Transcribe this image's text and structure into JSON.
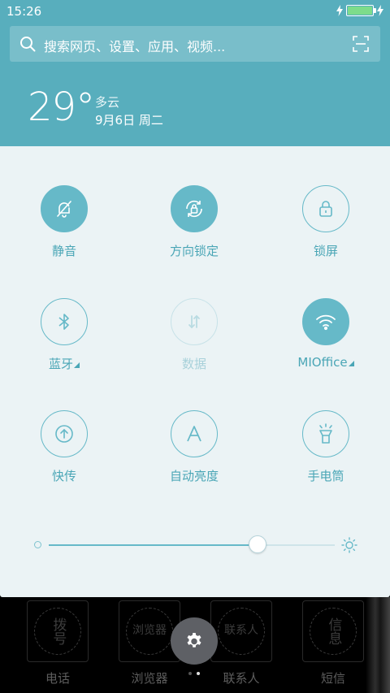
{
  "status_bar": {
    "time": "15:26",
    "battery_percent": 100
  },
  "search": {
    "placeholder": "搜索网页、设置、应用、视频..."
  },
  "weather": {
    "temperature": "29°",
    "condition": "多云",
    "date": "9月6日  周二"
  },
  "toggles": [
    {
      "id": "mute",
      "label": "静音",
      "icon": "bell-off-icon",
      "state": "on"
    },
    {
      "id": "rotation-lock",
      "label": "方向锁定",
      "icon": "rotation-lock-icon",
      "state": "on"
    },
    {
      "id": "lock-screen",
      "label": "锁屏",
      "icon": "padlock-icon",
      "state": "off"
    },
    {
      "id": "bluetooth",
      "label": "蓝牙",
      "icon": "bluetooth-icon",
      "state": "off",
      "has_menu": true
    },
    {
      "id": "mobile-data",
      "label": "数据",
      "icon": "data-arrows-icon",
      "state": "disabled"
    },
    {
      "id": "wifi",
      "label": "MIOffice",
      "icon": "wifi-icon",
      "state": "on",
      "has_menu": true
    },
    {
      "id": "quick-transfer",
      "label": "快传",
      "icon": "upload-circle-icon",
      "state": "off"
    },
    {
      "id": "auto-brightness",
      "label": "自动亮度",
      "icon": "letter-a-icon",
      "state": "off"
    },
    {
      "id": "flashlight",
      "label": "手电筒",
      "icon": "flashlight-icon",
      "state": "off"
    }
  ],
  "brightness": {
    "level_fraction": 0.73
  },
  "dock": [
    {
      "label": "电话",
      "icon_glyphs": "拨号"
    },
    {
      "label": "浏览器",
      "icon_glyphs": "浏览器"
    },
    {
      "label": "联系人",
      "icon_glyphs": "联系人"
    },
    {
      "label": "短信",
      "icon_glyphs": "信息"
    }
  ],
  "colors": {
    "accent": "#66b9c8",
    "header": "#58aebd",
    "panel": "#ebf3f5"
  }
}
